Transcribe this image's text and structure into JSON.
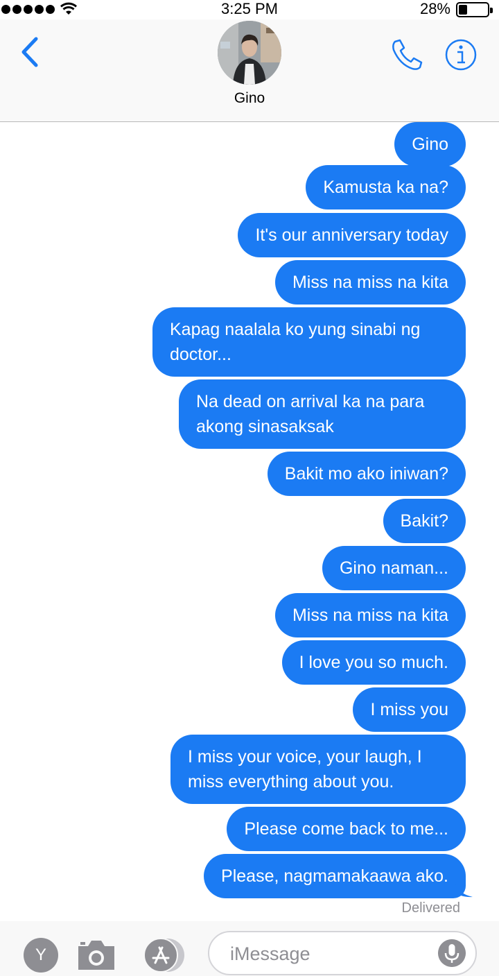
{
  "status_bar": {
    "time": "3:25 PM",
    "battery_percent": "28%",
    "battery_level": 0.28
  },
  "header": {
    "contact_name": "Gino"
  },
  "messages": [
    {
      "text": "Gino"
    },
    {
      "text": "Kamusta ka na?"
    },
    {
      "text": "It's our anniversary today"
    },
    {
      "text": "Miss na miss na kita"
    },
    {
      "text": "Kapag naalala ko yung sinabi ng doctor..."
    },
    {
      "text": "Na dead on arrival ka na para akong sinasaksak"
    },
    {
      "text": "Bakit mo ako iniwan?"
    },
    {
      "text": "Bakit?"
    },
    {
      "text": "Gino naman..."
    },
    {
      "text": "Miss na miss na kita"
    },
    {
      "text": "I love you so much."
    },
    {
      "text": "I miss you"
    },
    {
      "text": "I miss your voice, your laugh, I miss everything about you."
    },
    {
      "text": "Please come back to me..."
    },
    {
      "text": "Please, nagmamakaawa ako."
    }
  ],
  "status": "Delivered",
  "composer": {
    "placeholder": "iMessage",
    "app_badge_letter": "Y"
  },
  "colors": {
    "accent": "#1b7bf3",
    "bubble_text": "#ffffff",
    "icon_gray": "#8e8e93"
  }
}
